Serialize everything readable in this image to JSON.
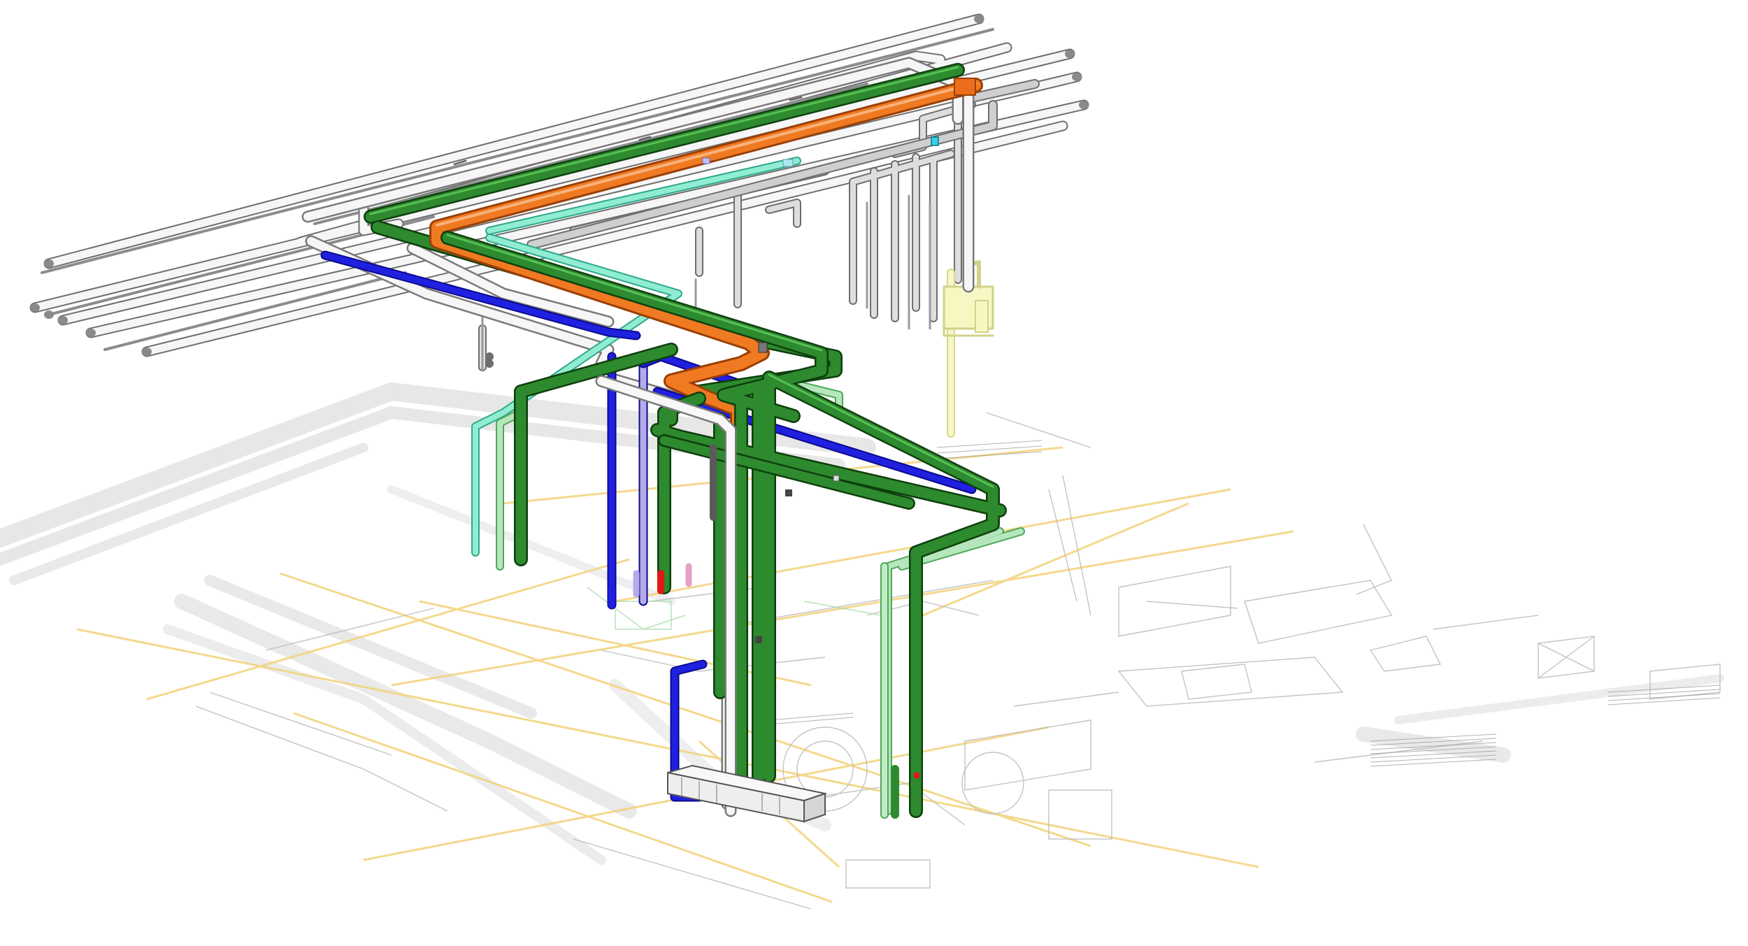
{
  "view": {
    "kind": "isometric MEP pipe routing model",
    "background": "#ffffff"
  },
  "pipe_systems": [
    {
      "id": "sanitary-green",
      "color": "#1f6e1f",
      "highlight": "#3fa23f"
    },
    {
      "id": "heating-orange",
      "color": "#e8731e",
      "highlight": "#f5a060"
    },
    {
      "id": "water-blue",
      "color": "#1a1ad6",
      "highlight": "#5a5af0"
    },
    {
      "id": "mint",
      "color": "#5fd6b4",
      "highlight": "#a8f0dc"
    },
    {
      "id": "light-green",
      "color": "#8fd09a",
      "highlight": "#c8eccc"
    },
    {
      "id": "white-grey",
      "color": "#e8e8e8",
      "highlight": "#ffffff"
    },
    {
      "id": "grey",
      "color": "#a0a0a0",
      "highlight": "#d8d8d8"
    },
    {
      "id": "lavender",
      "color": "#b0a8e0",
      "highlight": "#dcd6f6"
    },
    {
      "id": "red",
      "color": "#e01818",
      "highlight": "#ff6060"
    },
    {
      "id": "pale-yellow",
      "color": "#f0f0a8",
      "highlight": "#fbfbd8"
    }
  ],
  "floor_plan": {
    "gridline_color": "#f3d27a",
    "linework_color": "#b8b8b8",
    "shadow_color": "#cfcfcf"
  }
}
